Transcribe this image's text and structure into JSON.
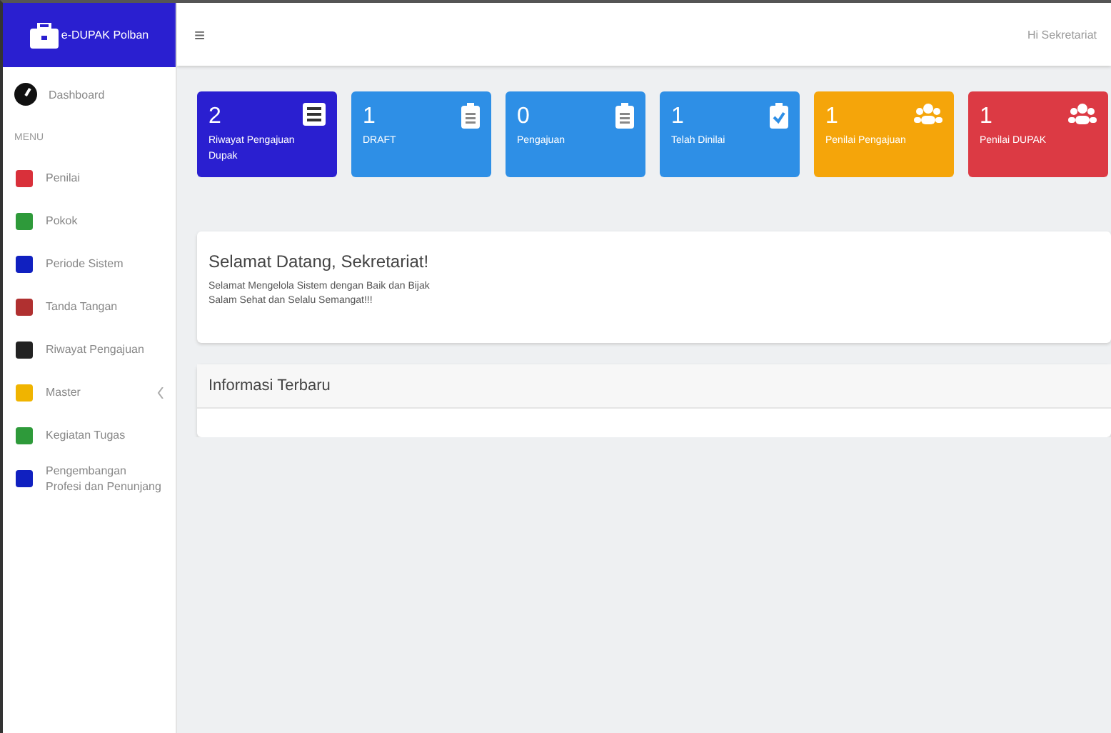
{
  "brand": {
    "title": "e-DUPAK Polban"
  },
  "sidebar": {
    "top_item": {
      "label": "Dashboard"
    },
    "section": "MENU",
    "items": [
      {
        "label": "Penilai",
        "color": "#d9303a",
        "expandable": false
      },
      {
        "label": "Pokok",
        "color": "#2e9a3a",
        "expandable": false
      },
      {
        "label": "Periode Sistem",
        "color": "#1020c0",
        "expandable": false
      },
      {
        "label": "Tanda Tangan",
        "color": "#b03030",
        "expandable": false
      },
      {
        "label": "Riwayat Pengajuan",
        "color": "#222222",
        "expandable": false
      },
      {
        "label": "Master",
        "color": "#f0b400",
        "expandable": true
      },
      {
        "label": "Kegiatan Tugas",
        "color": "#2e9a3a",
        "expandable": false
      },
      {
        "label": "Pengembangan Profesi dan Penunjang",
        "color": "#1020c0",
        "expandable": false
      }
    ]
  },
  "header": {
    "menu_glyph": "≡",
    "user": "Hi Sekretariat"
  },
  "cards": [
    {
      "count": "2",
      "label": "Riwayat Pengajuan Dupak",
      "color": "#2a1fd0"
    },
    {
      "count": "1",
      "label": "DRAFT",
      "color": "#2e8fe6"
    },
    {
      "count": "0",
      "label": "Pengajuan",
      "color": "#2e8fe6"
    },
    {
      "count": "1",
      "label": "Telah Dinilai",
      "color": "#2e8fe6"
    },
    {
      "count": "1",
      "label": "Penilai Pengajuan",
      "color": "#f5a50a"
    },
    {
      "count": "1",
      "label": "Penilai DUPAK",
      "color": "#dc3a44"
    }
  ],
  "welcome": {
    "title": "Selamat Datang, Sekretariat!",
    "lines": [
      "Selamat Mengelola Sistem dengan Baik dan Bijak",
      "Salam Sehat dan Selalu Semangat!!!"
    ]
  },
  "info": {
    "title": "Informasi Terbaru"
  }
}
